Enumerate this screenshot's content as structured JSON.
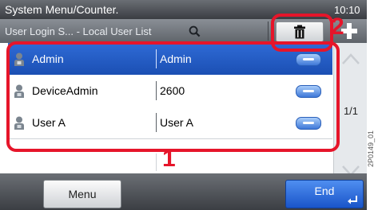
{
  "header": {
    "title": "System Menu/Counter.",
    "clock": "10:10"
  },
  "breadcrumb": "User Login S... - Local User List",
  "users": [
    {
      "name": "Admin",
      "login": "Admin",
      "selected": true
    },
    {
      "name": "DeviceAdmin",
      "login": "2600",
      "selected": false
    },
    {
      "name": "User A",
      "login": "User A",
      "selected": false
    }
  ],
  "scroll": {
    "page": "1/1"
  },
  "footer": {
    "menu_label": "Menu",
    "end_label": "End"
  },
  "callouts": {
    "one": "1",
    "two": "2"
  },
  "side_code": "2P0149_01",
  "colors": {
    "highlight": "#e6152a",
    "selection": "#2a62cf",
    "end_button": "#2f6fe0"
  }
}
